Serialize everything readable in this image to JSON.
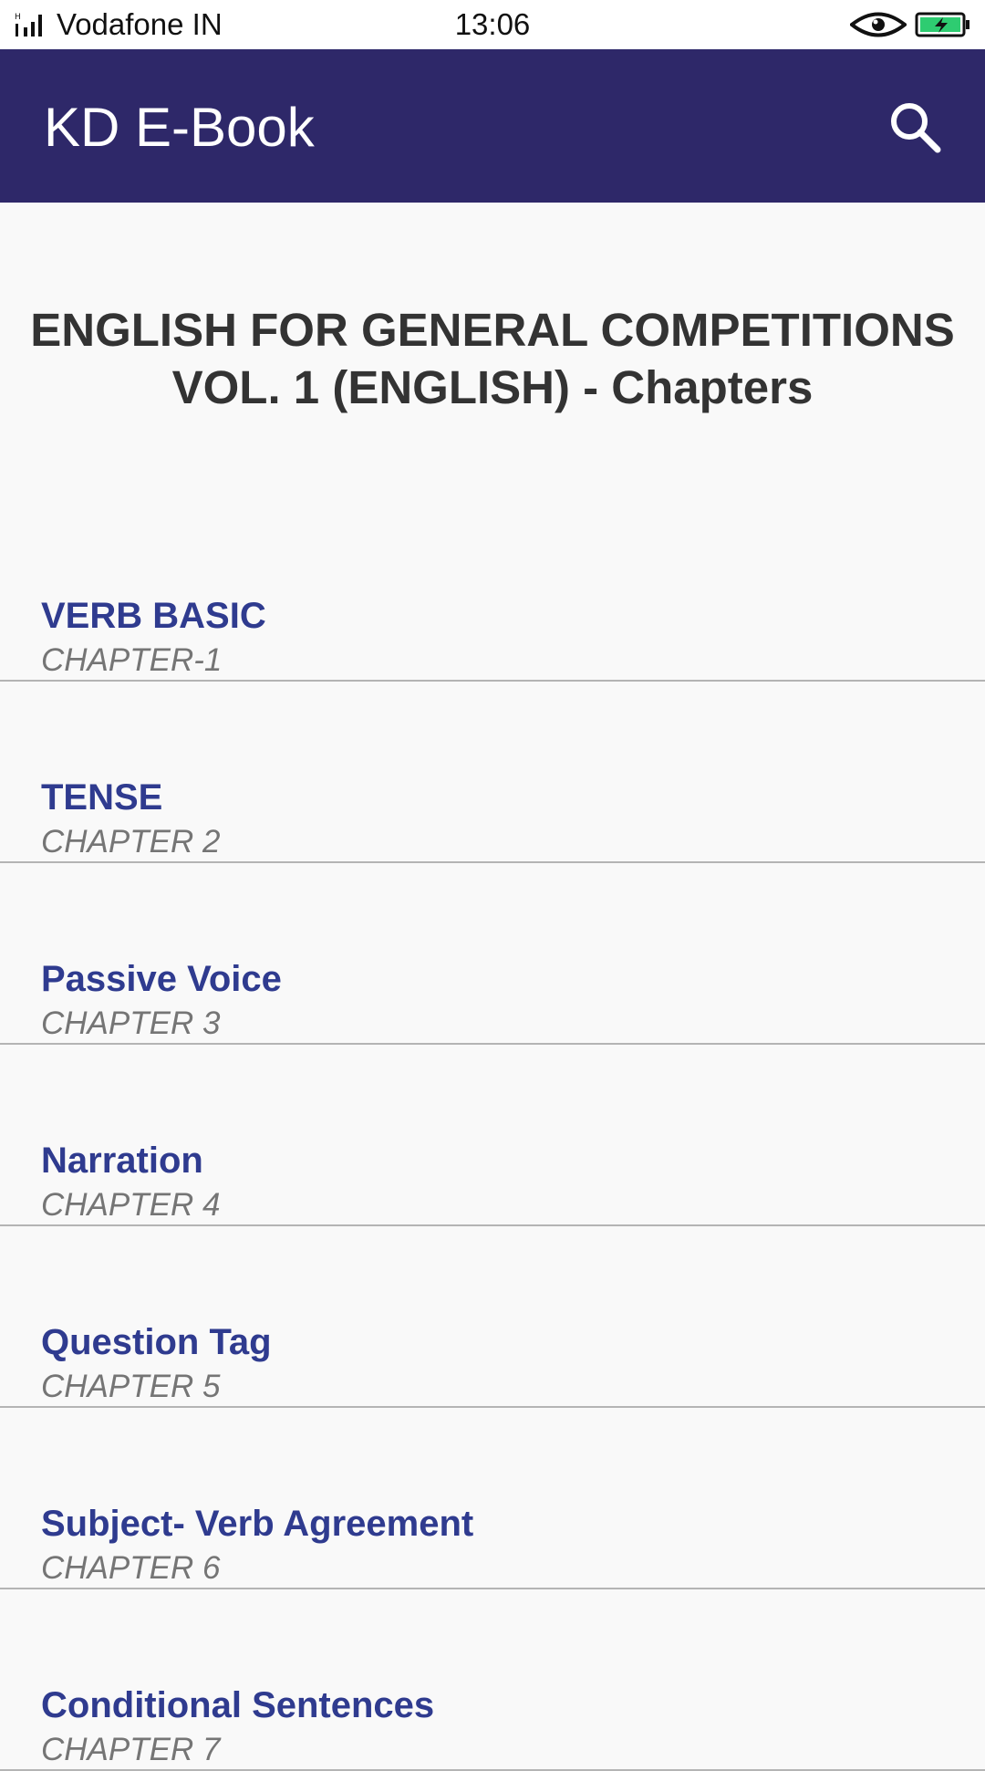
{
  "status_bar": {
    "carrier": "Vodafone IN",
    "time": "13:06",
    "icons": [
      "signal-icon",
      "eye-icon",
      "battery-charging-icon"
    ],
    "battery_color": "#2ecc71"
  },
  "app_bar": {
    "title": "KD E-Book",
    "search_icon": "search-icon",
    "background": "#2e2869"
  },
  "page": {
    "title_line1": "ENGLISH FOR GENERAL COMPETITIONS",
    "title_line2": "VOL. 1 (ENGLISH) - Chapters"
  },
  "chapters": [
    {
      "title": "VERB BASIC",
      "subtitle": "CHAPTER-1"
    },
    {
      "title": "TENSE",
      "subtitle": "CHAPTER 2"
    },
    {
      "title": "Passive Voice",
      "subtitle": "CHAPTER 3"
    },
    {
      "title": "Narration",
      "subtitle": "CHAPTER 4"
    },
    {
      "title": "Question Tag",
      "subtitle": "CHAPTER 5"
    },
    {
      "title": "Subject- Verb Agreement",
      "subtitle": "CHAPTER 6"
    },
    {
      "title": "Conditional Sentences",
      "subtitle": "CHAPTER 7"
    }
  ],
  "colors": {
    "chapter_title": "#2f3b8f",
    "chapter_subtitle": "#757575",
    "divider": "#b4b4b4"
  }
}
